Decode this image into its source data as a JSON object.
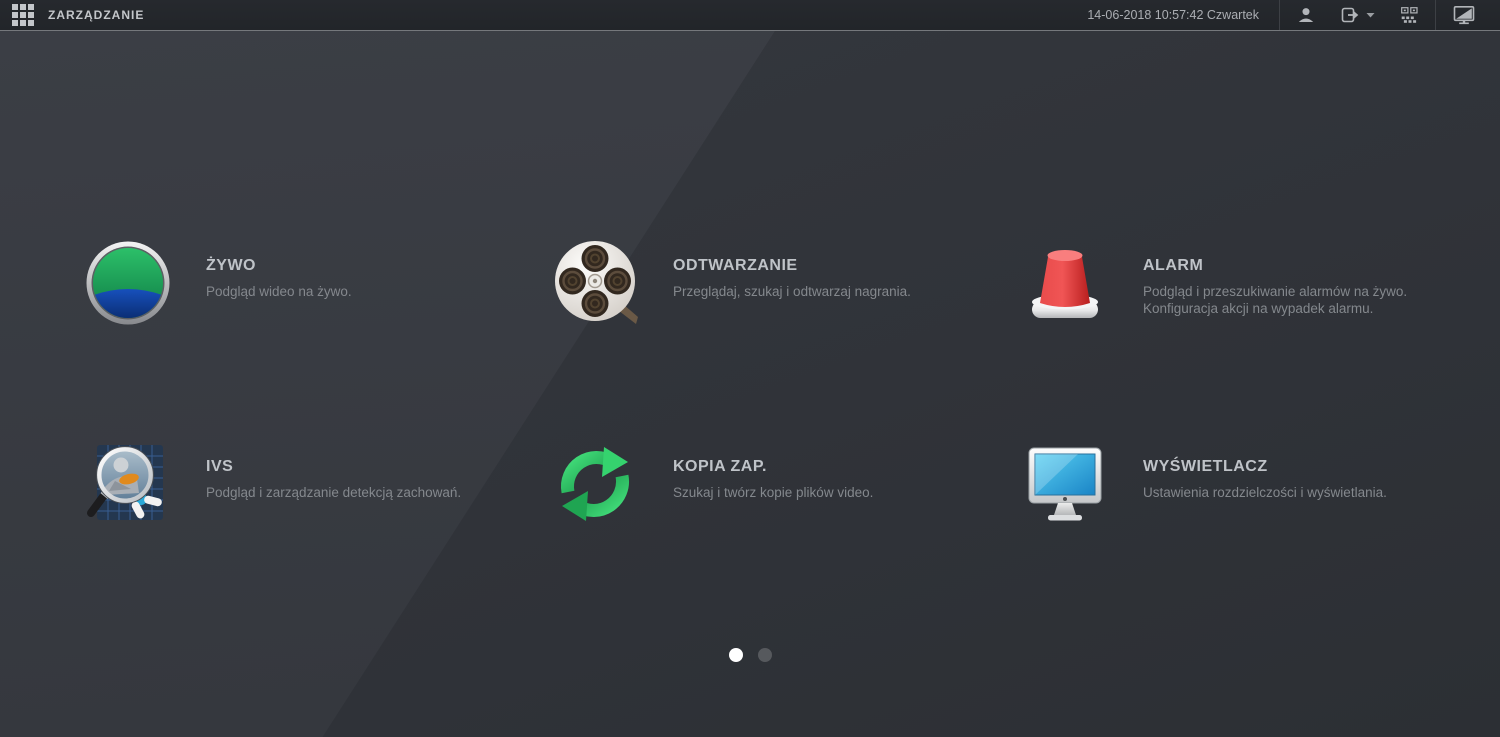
{
  "header": {
    "title": "ZARZĄDZANIE",
    "datetime": "14-06-2018 10:57:42 Czwartek",
    "icons": [
      "apps-grid-icon",
      "user-icon",
      "logout-icon",
      "qr-code-icon",
      "display-switch-icon"
    ]
  },
  "menu": {
    "items": [
      {
        "id": "live",
        "icon": "live-view-icon",
        "title": "ŻYWO",
        "desc1": "Podgląd wideo na żywo."
      },
      {
        "id": "playback",
        "icon": "playback-reel-icon",
        "title": "ODTWARZANIE",
        "desc1": "Przeglądaj, szukaj i odtwarzaj nagrania."
      },
      {
        "id": "alarm",
        "icon": "alarm-siren-icon",
        "title": "ALARM",
        "desc1": "Podgląd i przeszukiwanie alarmów na żywo.",
        "desc2": "Konfiguracja akcji na wypadek alarmu."
      },
      {
        "id": "ivs",
        "icon": "ivs-search-icon",
        "title": "IVS",
        "desc1": "Podgląd i zarządzanie detekcją zachowań."
      },
      {
        "id": "backup",
        "icon": "backup-sync-icon",
        "title": "KOPIA ZAP.",
        "desc1": "Szukaj i twórz kopie plików video."
      },
      {
        "id": "display",
        "icon": "display-monitor-icon",
        "title": "WYŚWIETLACZ",
        "desc1": "Ustawienia rozdzielczości i wyświetlania."
      }
    ]
  },
  "pagination": {
    "dots": 2,
    "active_index": 0
  },
  "colors": {
    "header_bg": "#24272b",
    "body_bg": "#33363c",
    "band_light": "#3b3e45",
    "title_text": "#bfc3c8",
    "desc_text": "#84888d",
    "live_green": "#1fa55c",
    "live_blue": "#0d3a9a",
    "alarm_red": "#e23434",
    "backup_green": "#2fc865",
    "screen_cyan": "#38b6e6"
  }
}
